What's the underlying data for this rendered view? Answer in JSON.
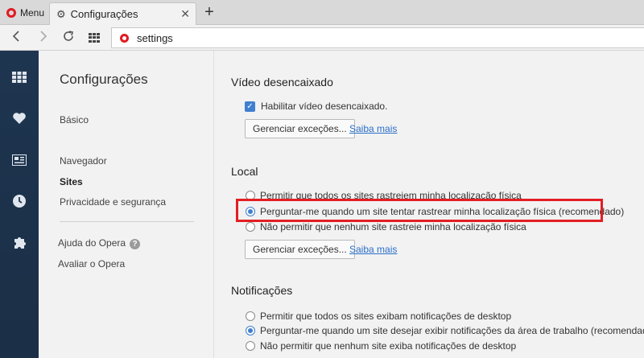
{
  "browser": {
    "menu_label": "Menu",
    "tab_title": "Configurações",
    "tab_close": "✕",
    "new_tab": "+",
    "address": "settings"
  },
  "settings_nav": {
    "title": "Configurações",
    "items": [
      {
        "label": "Básico"
      },
      {
        "label": "Navegador"
      },
      {
        "label": "Sites"
      },
      {
        "label": "Privacidade e segurança"
      }
    ],
    "help": "Ajuda do Opera",
    "help_icon": "?",
    "rate": "Avaliar o Opera",
    "active_item": "Sites"
  },
  "video_section": {
    "title": "Vídeo desencaixado",
    "checkbox_label": "Habilitar vídeo desencaixado.",
    "checkbox_checked": true,
    "manage_button": "Gerenciar exceções...",
    "learn_more": "Saiba mais"
  },
  "location_section": {
    "title": "Local",
    "options": [
      {
        "label": "Permitir que todos os sites rastreiem minha localização física",
        "checked": false
      },
      {
        "label": "Perguntar-me quando um site tentar rastrear minha localização física (recomendado)",
        "checked": true
      },
      {
        "label": "Não permitir que nenhum site rastreie minha localização física",
        "checked": false
      }
    ],
    "manage_button": "Gerenciar exceções...",
    "learn_more": "Saiba mais"
  },
  "notifications_section": {
    "title": "Notificações",
    "options": [
      {
        "label": "Permitir que todos os sites exibam notificações de desktop",
        "checked": false
      },
      {
        "label": "Perguntar-me quando um site desejar exibir notificações da área de trabalho (recomendado)",
        "checked": true
      },
      {
        "label": "Não permitir que nenhum site exiba notificações de desktop",
        "checked": false
      }
    ]
  },
  "colors": {
    "accent": "#3f7fcf",
    "highlight": "#e31e24",
    "sidebar": "#1e3550"
  }
}
